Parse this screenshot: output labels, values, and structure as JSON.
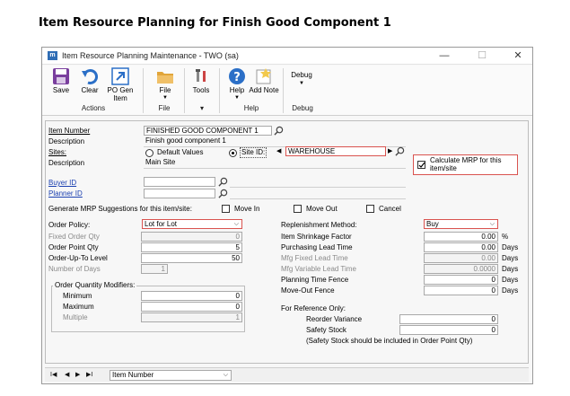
{
  "doc_title": "Item Resource Planning for Finish Good Component 1",
  "window": {
    "title": "Item Resource Planning Maintenance  -  TWO (sa)",
    "minimize": "—",
    "maximize": "☐",
    "close": "✕"
  },
  "ribbon": {
    "save": "Save",
    "clear": "Clear",
    "po_gen_item": "PO Gen Item",
    "file": "File",
    "tools": "Tools",
    "help": "Help",
    "add_note": "Add Note",
    "debug": "Debug",
    "groups": {
      "actions": "Actions",
      "file": "File",
      "tools": "▾",
      "help": "Help",
      "debug": "Debug"
    },
    "colors": {
      "save": "#7a3f9e",
      "clear": "#2b6fc7",
      "po": "#2b6fc7",
      "file": "#e1a53a",
      "help": "#2b6fc7",
      "note": "#f2c94c"
    }
  },
  "form": {
    "item_number_label": "Item Number",
    "item_number": "FINISHED GOOD COMPONENT 1",
    "description_label": "Description",
    "description": "Finish good component 1",
    "sites_label": "Sites:",
    "default_values": "Default Values",
    "site_id": "Site ID:",
    "site_value": "WAREHOUSE",
    "site_description_label": "Description",
    "site_description": "Main Site",
    "calc_mrp": "Calculate MRP for this item/site",
    "calc_mrp_checked": true,
    "buyer_id_label": "Buyer ID",
    "planner_id_label": "Planner ID",
    "gen_mrp_label": "Generate MRP Suggestions for this item/site:",
    "move_in": "Move In",
    "move_out": "Move Out",
    "cancel": "Cancel",
    "left": {
      "order_policy_label": "Order Policy:",
      "order_policy": "Lot for Lot",
      "fixed_order_qty_label": "Fixed Order Qty",
      "fixed_order_qty": "0",
      "order_point_qty_label": "Order Point Qty",
      "order_point_qty": "5",
      "order_up_to_label": "Order-Up-To Level",
      "order_up_to": "50",
      "number_of_days_label": "Number of Days",
      "number_of_days": "1",
      "oqm_title": "Order Quantity Modifiers:",
      "minimum_label": "Minimum",
      "minimum": "0",
      "maximum_label": "Maximum",
      "maximum": "0",
      "multiple_label": "Multiple",
      "multiple": "1"
    },
    "right": {
      "replenishment_label": "Replenishment Method:",
      "replenishment": "Buy",
      "shrinkage_label": "Item Shrinkage Factor",
      "shrinkage": "0.00",
      "shrinkage_unit": "%",
      "purchasing_label": "Purchasing Lead Time",
      "purchasing": "0.00",
      "mfg_fixed_label": "Mfg Fixed Lead Time",
      "mfg_fixed": "0.00",
      "mfg_variable_label": "Mfg Variable Lead Time",
      "mfg_variable": "0.0000",
      "planning_fence_label": "Planning Time Fence",
      "planning_fence": "0",
      "move_out_fence_label": "Move-Out Fence",
      "move_out_fence": "0",
      "days": "Days",
      "ref_only": "For Reference Only:",
      "reorder_variance_label": "Reorder Variance",
      "reorder_variance": "0",
      "safety_stock_label": "Safety Stock",
      "safety_stock": "0",
      "safety_note": "(Safety Stock should be included in Order Point Qty)"
    }
  },
  "statusbar": {
    "first": "I◀",
    "prev": "◀",
    "next": "▶",
    "last": "▶I",
    "sort": "Item Number"
  }
}
